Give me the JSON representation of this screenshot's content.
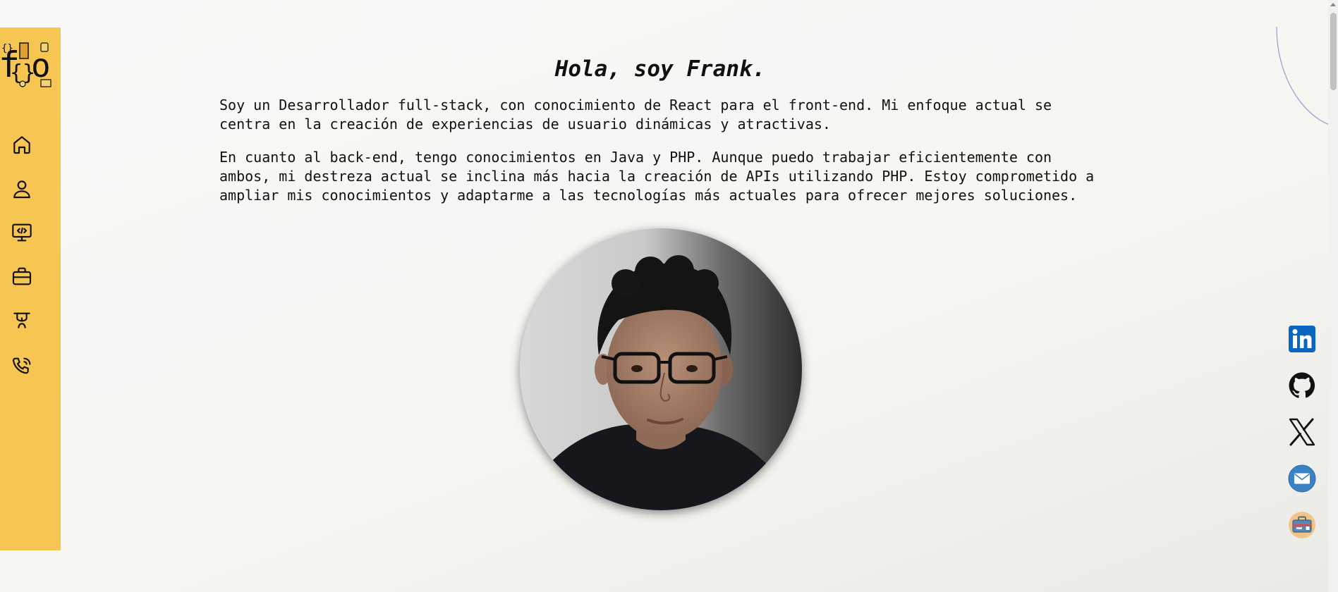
{
  "hero": {
    "title": "Hola, soy Frank.",
    "paragraph_1": "Soy un Desarrollador full-stack, con conocimiento de React para el front-end. Mi enfoque actual se centra en la creación de experiencias de usuario dinámicas y atractivas.",
    "paragraph_2": "En cuanto al back-end, tengo conocimientos en Java y PHP. Aunque puedo trabajar eficientemente con ambos, mi destreza actual se inclina más hacia la creación de APIs utilizando PHP. Estoy comprometido a ampliar mis conocimientos y adaptarme a las tecnologías más actuales para ofrecer mejores soluciones."
  },
  "sidebar": {
    "logo": "fo-logo",
    "items": [
      {
        "icon": "home-icon"
      },
      {
        "icon": "user-icon"
      },
      {
        "icon": "code-monitor-icon"
      },
      {
        "icon": "briefcase-icon"
      },
      {
        "icon": "graduation-icon"
      },
      {
        "icon": "phone-icon"
      }
    ]
  },
  "social": [
    {
      "icon": "linkedin-icon"
    },
    {
      "icon": "github-icon"
    },
    {
      "icon": "x-twitter-icon"
    },
    {
      "icon": "email-icon"
    },
    {
      "icon": "portfolio-briefcase-icon"
    }
  ],
  "colors": {
    "sidebar": "#f7c652",
    "linkedin": "#0a66c2",
    "email": "#3b82c4",
    "portfolio_bg": "#f1c48a"
  }
}
